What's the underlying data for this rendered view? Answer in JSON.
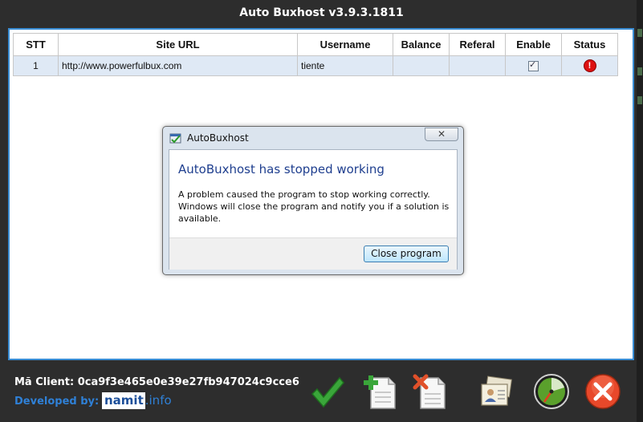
{
  "window": {
    "title": "Auto Buxhost v3.9.3.1811"
  },
  "table": {
    "columns": [
      "STT",
      "Site URL",
      "Username",
      "Balance",
      "Referal",
      "Enable",
      "Status"
    ],
    "rows": [
      {
        "stt": "1",
        "site_url": "http://www.powerfulbux.com",
        "username": "tiente",
        "balance": "",
        "referal": "",
        "enable": "checked",
        "status": "error"
      }
    ]
  },
  "dialog": {
    "title": "AutoBuxhost",
    "close_glyph": "✕",
    "heading": "AutoBuxhost has stopped working",
    "message": "A problem caused the program to stop working correctly. Windows will close the program and notify you if a solution is available.",
    "button_label": "Close program"
  },
  "footer": {
    "client_label": "Mã Client: 0ca9f3e465e0e39e27fb947024c9cce6",
    "developed_label": "Developed by:",
    "brand_part1": "namit",
    "brand_part2": ".info",
    "status_glyph": "!"
  },
  "icons": [
    "checkmark-icon",
    "add-document-icon",
    "delete-document-icon",
    "contacts-icon",
    "clock-icon",
    "close-circle-icon"
  ],
  "colors": {
    "accent_border": "#3a8dd4",
    "row_bg": "#dfe9f5",
    "dialog_heading": "#1f3f8f",
    "brand_blue": "#2f80d6"
  }
}
